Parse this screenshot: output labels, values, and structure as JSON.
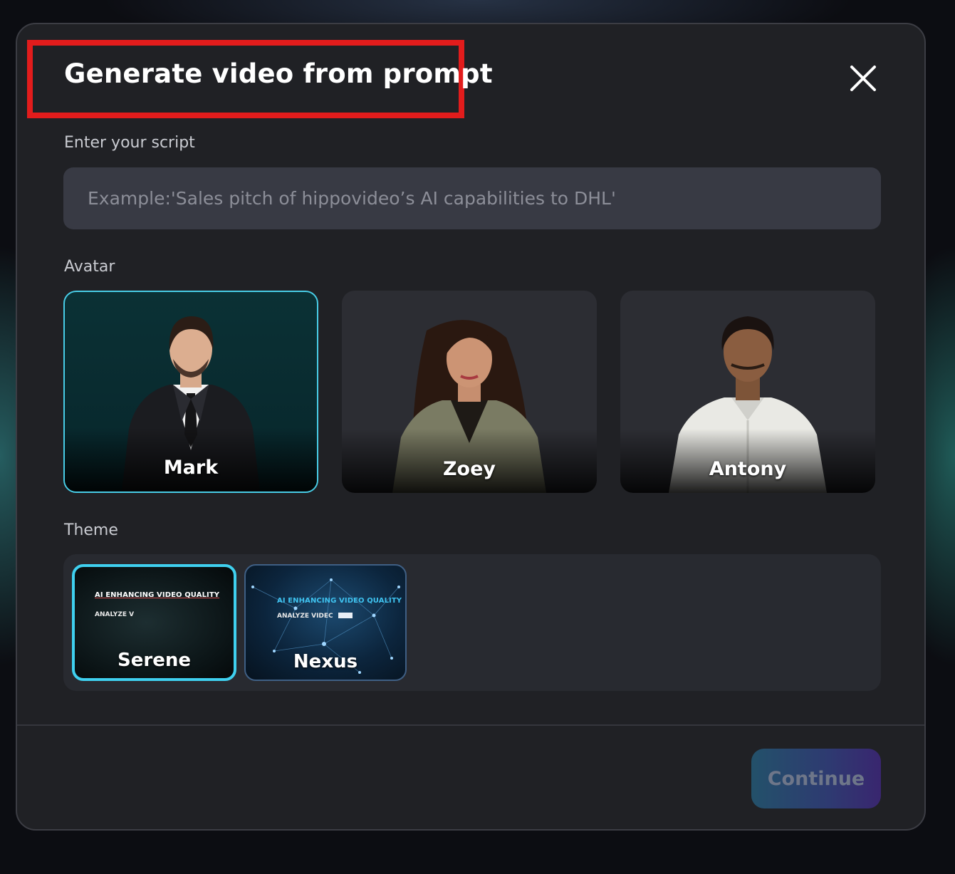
{
  "dialog": {
    "title": "Generate video from prompt",
    "close_icon": "close-icon"
  },
  "script": {
    "label": "Enter your script",
    "value": "",
    "placeholder": "Example:'Sales pitch of hippovideo’s AI capabilities to DHL'"
  },
  "avatar": {
    "label": "Avatar",
    "selected": "Mark",
    "options": [
      {
        "name": "Mark"
      },
      {
        "name": "Zoey"
      },
      {
        "name": "Antony"
      }
    ]
  },
  "theme": {
    "label": "Theme",
    "selected": "Serene",
    "options": [
      {
        "name": "Serene",
        "headline": "AI ENHANCING VIDEO QUALITY",
        "subline": "ANALYZE V"
      },
      {
        "name": "Nexus",
        "headline": "AI ENHANCING VIDEO QUALITY",
        "subline": "ANALYZE VIDEC"
      }
    ]
  },
  "footer": {
    "continue_label": "Continue"
  },
  "colors": {
    "highlight_box": "#e21c1c",
    "selection_accent": "#48cde7",
    "modal_background": "#202125",
    "continue_gradient_start": "#23516a",
    "continue_gradient_end": "#39266f"
  }
}
